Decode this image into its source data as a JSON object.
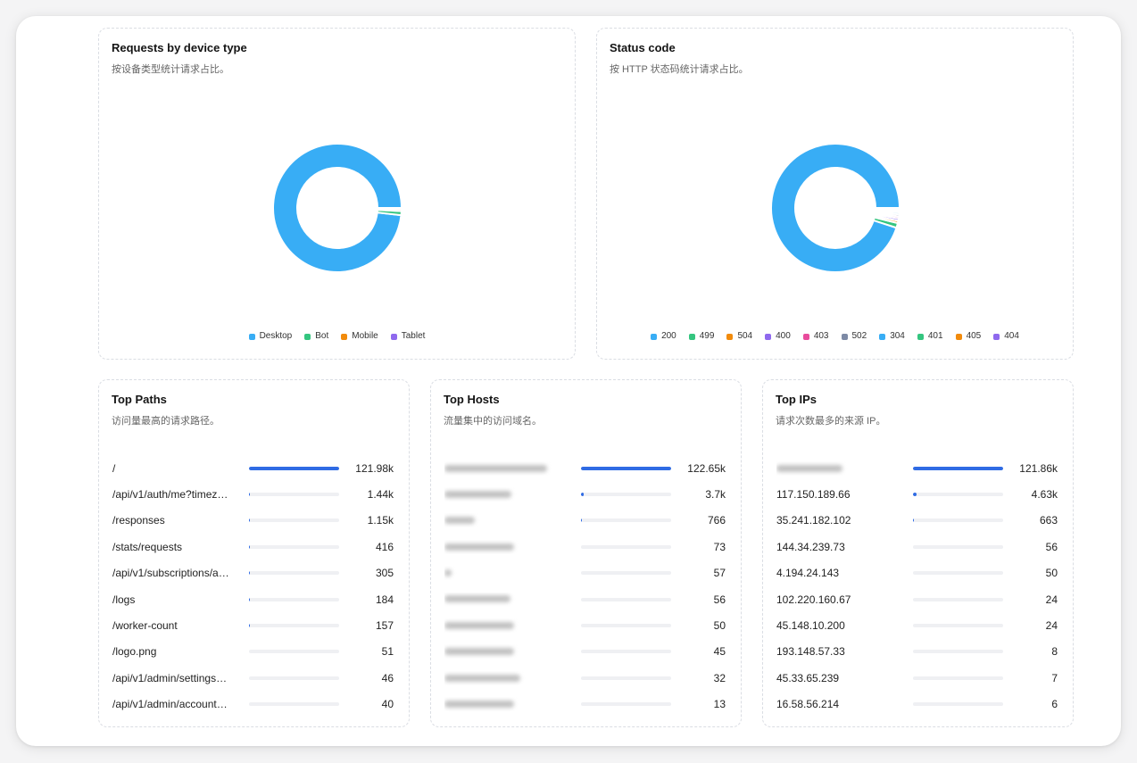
{
  "colors": {
    "palette": [
      "#38adf5",
      "#34c57f",
      "#f28b0c",
      "#8f69ee",
      "#e94b9c",
      "#7d8aa5"
    ],
    "bar_fill": "#2f6be4",
    "bar_track": "#eff0f3"
  },
  "chart_data": [
    {
      "type": "pie",
      "title": "Requests by device type",
      "subtitle": "按设备类型统计请求占比。",
      "categories": [
        "Desktop",
        "Bot",
        "Mobile",
        "Tablet"
      ],
      "values": [
        98.2,
        1.0,
        0.5,
        0.3
      ],
      "legend": "bottom"
    },
    {
      "type": "pie",
      "title": "Status code",
      "subtitle": "按 HTTP 状态码统计请求占比。",
      "categories": [
        "200",
        "499",
        "504",
        "400",
        "403",
        "502",
        "304",
        "401",
        "405",
        "404"
      ],
      "values": [
        95.0,
        1.2,
        0.6,
        0.6,
        0.5,
        0.5,
        0.5,
        0.4,
        0.4,
        0.3
      ],
      "legend": "bottom"
    }
  ],
  "top_paths": {
    "title": "Top Paths",
    "subtitle": "访问量最高的请求路径。",
    "rows": [
      {
        "label": "/",
        "value": "121.98k"
      },
      {
        "label": "/api/v1/auth/me?timez…",
        "value": "1.44k"
      },
      {
        "label": "/responses",
        "value": "1.15k"
      },
      {
        "label": "/stats/requests",
        "value": "416"
      },
      {
        "label": "/api/v1/subscriptions/a…",
        "value": "305"
      },
      {
        "label": "/logs",
        "value": "184"
      },
      {
        "label": "/worker-count",
        "value": "157"
      },
      {
        "label": "/logo.png",
        "value": "51"
      },
      {
        "label": "/api/v1/admin/settings…",
        "value": "46"
      },
      {
        "label": "/api/v1/admin/account…",
        "value": "40"
      }
    ]
  },
  "top_hosts": {
    "title": "Top Hosts",
    "subtitle": "流量集中的访问域名。",
    "rows": [
      {
        "value": "122.65k"
      },
      {
        "value": "3.7k"
      },
      {
        "value": "766"
      },
      {
        "value": "73"
      },
      {
        "value": "57"
      },
      {
        "value": "56"
      },
      {
        "value": "50"
      },
      {
        "value": "45"
      },
      {
        "value": "32"
      },
      {
        "value": "13"
      }
    ]
  },
  "top_ips": {
    "title": "Top IPs",
    "subtitle": "请求次数最多的来源 IP。",
    "rows": [
      {
        "value": "121.86k"
      },
      {
        "label": "117.150.189.66",
        "value": "4.63k"
      },
      {
        "label": "35.241.182.102",
        "value": "663"
      },
      {
        "label": "144.34.239.73",
        "value": "56"
      },
      {
        "label": "4.194.24.143",
        "value": "50"
      },
      {
        "label": "102.220.160.67",
        "value": "24"
      },
      {
        "label": "45.148.10.200",
        "value": "24"
      },
      {
        "label": "193.148.57.33",
        "value": "8"
      },
      {
        "label": "45.33.65.239",
        "value": "7"
      },
      {
        "label": "16.58.56.214",
        "value": "6"
      }
    ]
  }
}
